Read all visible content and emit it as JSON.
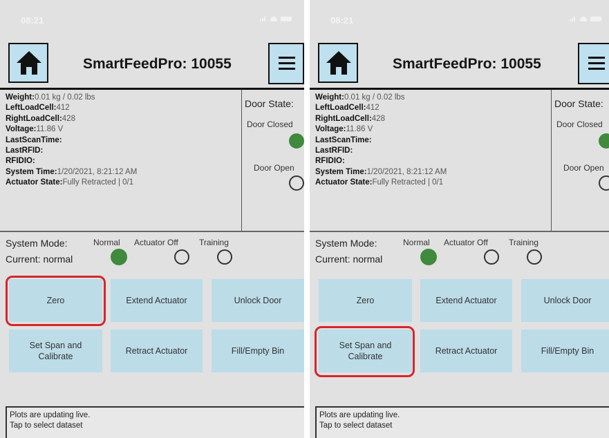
{
  "status_bar": {
    "time": "08:21"
  },
  "header": {
    "title": "SmartFeedPro: 10055"
  },
  "info": {
    "weight_label": "Weight:",
    "weight_value": "0.01 kg / 0.02 lbs",
    "left_label": "LeftLoadCell:",
    "left_value": "412",
    "right_label": "RightLoadCell:",
    "right_value": "428",
    "voltage_label": "Voltage:",
    "voltage_value": "11.86 V",
    "lastscan_label": "LastScanTime:",
    "lastrfid_label": "LastRFID:",
    "rfidio_label": "RFIDIO:",
    "systime_label": "System Time:",
    "systime_value": "1/20/2021, 8:21:12 AM",
    "actuator_label": "Actuator State:",
    "actuator_value": "Fully Retracted | 0/1"
  },
  "door": {
    "title": "Door State:",
    "closed_label": "Door Closed",
    "open_label": "Door Open",
    "state": "closed"
  },
  "mode": {
    "label": "System Mode:",
    "current": "Current: normal",
    "options": [
      "Normal",
      "Actuator Off",
      "Training"
    ],
    "selected": "Normal"
  },
  "buttons": {
    "zero": "Zero",
    "extend": "Extend Actuator",
    "unlock": "Unlock Door",
    "span": "Set Span and Calibrate",
    "retract": "Retract Actuator",
    "fill": "Fill/Empty Bin"
  },
  "plots": {
    "line1": "Plots are updating live.",
    "line2": "Tap to select dataset"
  },
  "highlights": {
    "left_panel": "zero-button",
    "right_panel": "set-span-calibrate-button"
  },
  "colors": {
    "highlight": "#d5262b",
    "button": "#bcdce8",
    "indicator_on": "#3f8a3c",
    "screen_bg": "#e1e1e1"
  }
}
